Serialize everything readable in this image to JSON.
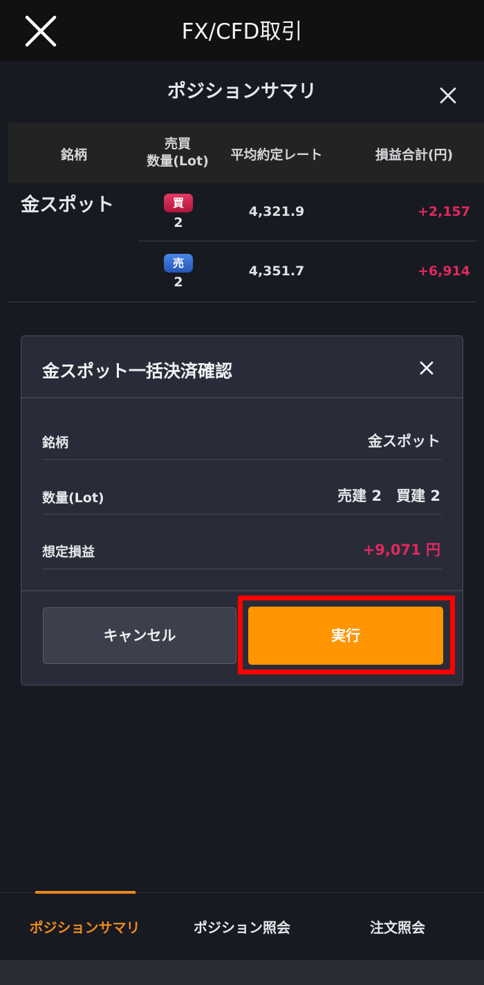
{
  "app": {
    "title": "FX/CFD取引"
  },
  "panel": {
    "title": "ポジションサマリ",
    "table": {
      "headers": {
        "symbol": "銘柄",
        "side_qty_line1": "売買",
        "side_qty_line2": "数量(Lot)",
        "avg_rate": "平均約定レート",
        "pl_total": "損益合計(円)"
      },
      "symbol": "金スポット",
      "rows": [
        {
          "side": "買",
          "qty": "2",
          "rate": "4,321.9",
          "pl": "+2,157",
          "side_color": "#c81e48"
        },
        {
          "side": "売",
          "qty": "2",
          "rate": "4,351.7",
          "pl": "+6,914",
          "side_color": "#3a6fd0"
        }
      ]
    }
  },
  "dialog": {
    "title": "金スポット一括決済確認",
    "fields": [
      {
        "label": "銘柄",
        "value": "金スポット"
      },
      {
        "label": "数量(Lot)",
        "value": "売建 2　買建 2"
      },
      {
        "label": "想定損益",
        "value": "+9,071 円"
      }
    ],
    "cancel_label": "キャンセル",
    "execute_label": "実行"
  },
  "tabs": [
    {
      "label": "ポジションサマリ",
      "active": true
    },
    {
      "label": "ポジション照会",
      "active": false
    },
    {
      "label": "注文照会",
      "active": false
    }
  ],
  "colors": {
    "accent": "#ff9500",
    "profit": "#e2285e",
    "highlight": "#ff0000"
  }
}
